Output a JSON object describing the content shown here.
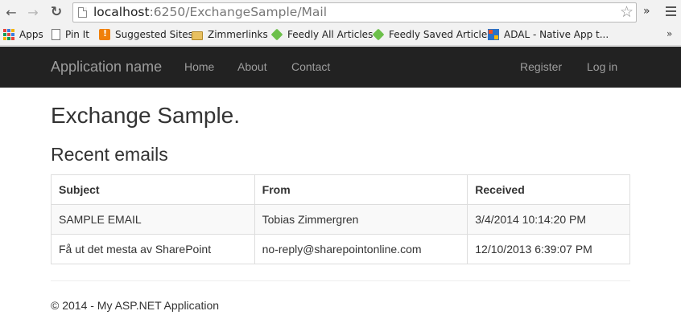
{
  "browser": {
    "url_host": "localhost",
    "url_path": ":6250/ExchangeSample/Mail",
    "bookmarks": [
      {
        "label": "Apps",
        "icon": "apps-grid-icon"
      },
      {
        "label": "Pin It",
        "icon": "page-icon"
      },
      {
        "label": "Suggested Sites",
        "icon": "suggested-sites-icon"
      },
      {
        "label": "Zimmerlinks",
        "icon": "folder-icon"
      },
      {
        "label": "Feedly All Articles",
        "icon": "feedly-icon"
      },
      {
        "label": "Feedly Saved Articles",
        "icon": "feedly-icon"
      },
      {
        "label": "ADAL - Native App t...",
        "icon": "adal-icon"
      }
    ],
    "more_bookmarks": "»"
  },
  "navbar": {
    "brand": "Application name",
    "links": [
      "Home",
      "About",
      "Contact"
    ],
    "right_links": [
      "Register",
      "Log in"
    ],
    "background": "#222222",
    "link_color": "#9d9d9d"
  },
  "main": {
    "title": "Exchange Sample.",
    "section_title": "Recent emails",
    "table": {
      "headers": [
        "Subject",
        "From",
        "Received"
      ],
      "rows": [
        [
          "SAMPLE EMAIL",
          "Tobias Zimmergren",
          "3/4/2014 10:14:20 PM"
        ],
        [
          "Få ut det mesta av SharePoint",
          "no-reply@sharepointonline.com",
          "12/10/2013 6:39:07 PM"
        ]
      ]
    }
  },
  "footer": {
    "text": "© 2014 - My ASP.NET Application"
  }
}
